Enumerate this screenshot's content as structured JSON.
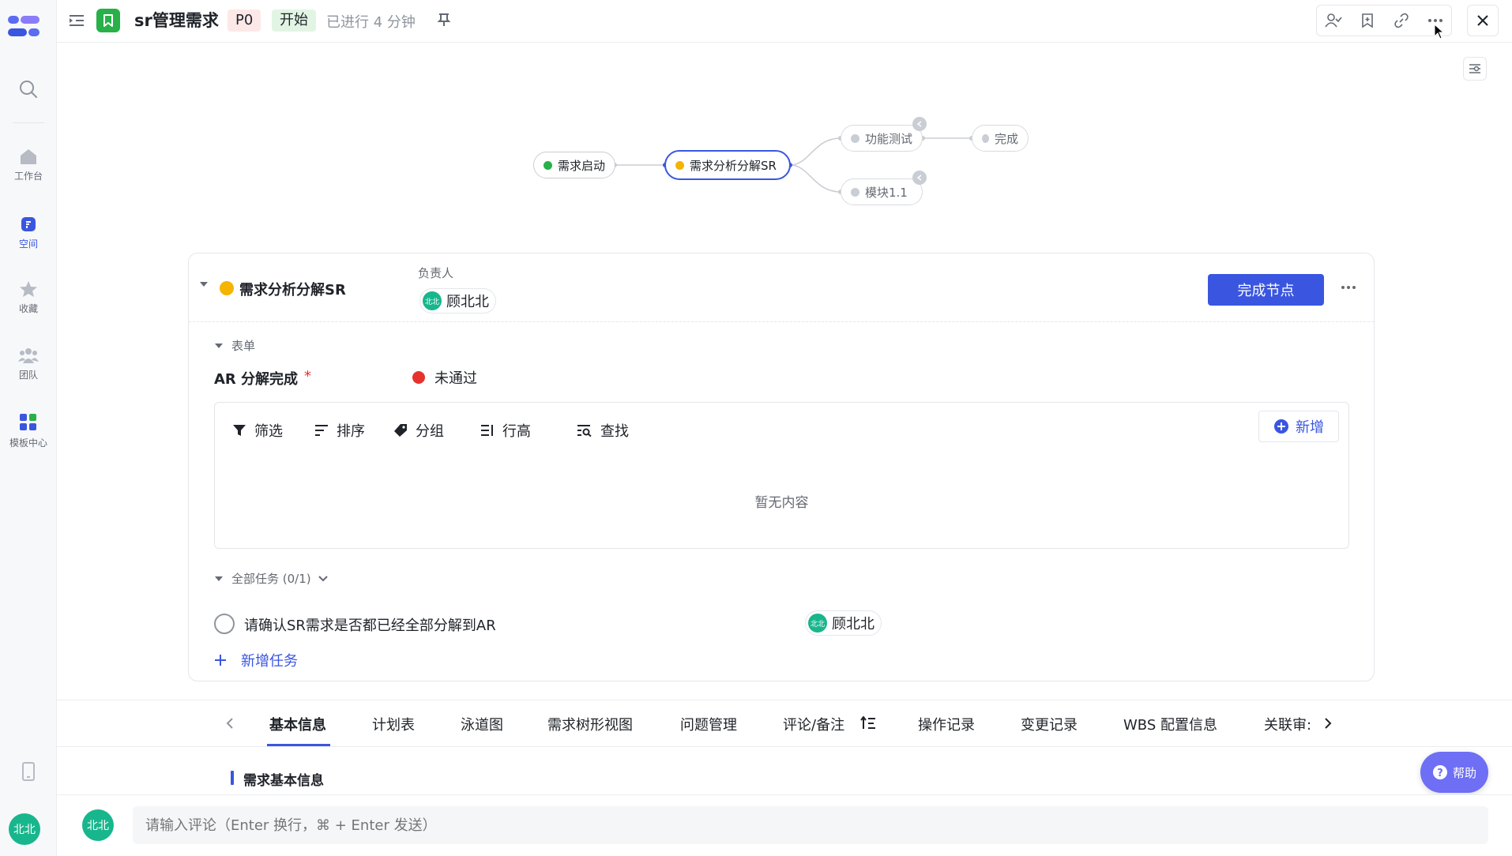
{
  "header": {
    "title": "sr管理需求",
    "priority": "P0",
    "status": "开始",
    "elapsed": "已进行 4 分钟"
  },
  "rail": {
    "items": [
      {
        "label": "工作台"
      },
      {
        "label": "空间"
      },
      {
        "label": "收藏"
      },
      {
        "label": "团队"
      },
      {
        "label": "模板中心"
      }
    ],
    "user_avatar": "北北"
  },
  "flow": {
    "nodes": [
      {
        "label": "需求启动",
        "status": "done"
      },
      {
        "label": "需求分析分解SR",
        "status": "in-progress"
      },
      {
        "label": "功能测试",
        "status": "pending"
      },
      {
        "label": "模块1.1",
        "status": "pending"
      },
      {
        "label": "完成",
        "status": "pending"
      }
    ]
  },
  "card": {
    "node_title": "需求分析分解SR",
    "assignee_label": "负责人",
    "assignee_name": "顾北北",
    "assignee_avatar": "北北",
    "complete_button": "完成节点",
    "form_section": "表单",
    "field_label": "AR 分解完成",
    "field_required_mark": "*",
    "field_value": "未通过",
    "toolbar": {
      "filter": "筛选",
      "sort": "排序",
      "group": "分组",
      "row_height": "行高",
      "search": "查找",
      "add": "新增"
    },
    "empty_text": "暂无内容",
    "tasks_section": "全部任务 (0/1)",
    "task_text": "请确认SR需求是否都已经全部分解到AR",
    "task_assignee": "顾北北",
    "add_task": "新增任务"
  },
  "tabs": {
    "items": [
      "基本信息",
      "计划表",
      "泳道图",
      "需求树形视图",
      "问题管理",
      "评论/备注",
      "操作记录",
      "变更记录",
      "WBS 配置信息",
      "关联审:"
    ],
    "active_index": 0
  },
  "section_title": "需求基本信息",
  "help_button": "帮助",
  "comment": {
    "avatar": "北北",
    "placeholder": "请输入评论（Enter 换行，⌘ + Enter 发送）"
  },
  "colors": {
    "brand": "#3a56e0",
    "done": "#27b148",
    "in_progress": "#f5b400",
    "failed": "#e5322d",
    "avatar": "#18b68c",
    "help": "#6e6ff5"
  }
}
